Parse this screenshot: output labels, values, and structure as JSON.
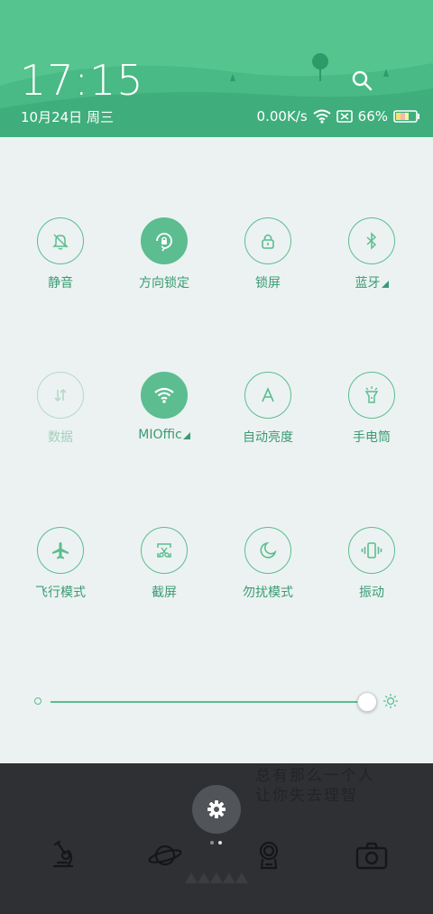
{
  "status": {
    "time": "17:15",
    "date": "10月24日 周三",
    "network_speed": "0.00K/s",
    "battery": "66%",
    "icons": [
      "wifi-icon",
      "no-sim-icon",
      "battery-icon"
    ]
  },
  "quick_settings": [
    {
      "label": "静音",
      "icon": "bell-off-icon",
      "state": "off"
    },
    {
      "label": "方向锁定",
      "icon": "rotation-lock-icon",
      "state": "on"
    },
    {
      "label": "锁屏",
      "icon": "lock-icon",
      "state": "off"
    },
    {
      "label": "蓝牙",
      "icon": "bluetooth-icon",
      "state": "off",
      "expandable": true
    },
    {
      "label": "数据",
      "icon": "mobile-data-icon",
      "state": "disabled"
    },
    {
      "label": "MIOffic",
      "icon": "wifi-icon",
      "state": "on",
      "expandable": true
    },
    {
      "label": "自动亮度",
      "icon": "auto-brightness-icon",
      "state": "off"
    },
    {
      "label": "手电筒",
      "icon": "flashlight-icon",
      "state": "off"
    },
    {
      "label": "飞行模式",
      "icon": "airplane-icon",
      "state": "off"
    },
    {
      "label": "截屏",
      "icon": "screenshot-icon",
      "state": "off"
    },
    {
      "label": "勿扰模式",
      "icon": "moon-icon",
      "state": "off"
    },
    {
      "label": "振动",
      "icon": "vibrate-icon",
      "state": "off"
    }
  ],
  "brightness": {
    "level": 1.0
  },
  "wallpaper_text": [
    "总有那么一个人",
    "让你失去理智"
  ],
  "colors": {
    "accent": "#5bbd90",
    "header": "#55c48e",
    "panel": "#ecf2f1"
  }
}
